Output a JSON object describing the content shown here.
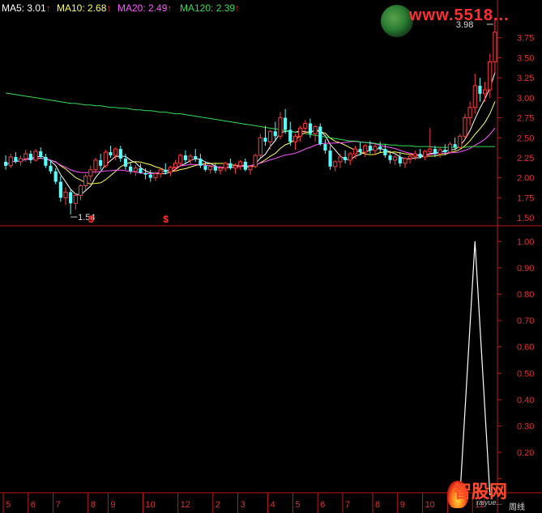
{
  "legend": [
    {
      "label": "MA5: 3.01",
      "color": "#ffffff"
    },
    {
      "label": "MA10: 2.68",
      "color": "#ffff55"
    },
    {
      "label": "MA20: 2.49",
      "color": "#ff55ff"
    },
    {
      "label": "MA120: 2.39",
      "color": "#33dd55"
    }
  ],
  "legend_arrow": "↑",
  "watermark_top": "www.5518...",
  "watermark_bottom": "智股网",
  "watermark_bottom_sub": "raiyue...",
  "period_label": "周线",
  "signal_marker": "$",
  "chart_data": [
    {
      "type": "candlestick",
      "panel": "price",
      "ylim": [
        1.42,
        4.0
      ],
      "yticks": [
        1.5,
        1.75,
        2.0,
        2.25,
        2.5,
        2.75,
        3.0,
        3.25,
        3.5,
        3.75
      ],
      "ytick_labels": [
        "1.50",
        "1.75",
        "2.00",
        "2.25",
        "2.50",
        "2.75",
        "3.00",
        "3.25",
        "3.50",
        "3.75"
      ],
      "annotations": [
        {
          "text": "1.54",
          "value": 1.54,
          "bar": 13
        },
        {
          "text": "3.98",
          "value": 3.98,
          "bar": 98
        }
      ],
      "signal_bars": [
        17,
        32
      ],
      "ohlc": [
        [
          2.2,
          2.28,
          2.1,
          2.15
        ],
        [
          2.15,
          2.3,
          2.12,
          2.26
        ],
        [
          2.26,
          2.32,
          2.18,
          2.2
        ],
        [
          2.2,
          2.28,
          2.15,
          2.24
        ],
        [
          2.24,
          2.35,
          2.2,
          2.3
        ],
        [
          2.3,
          2.34,
          2.18,
          2.22
        ],
        [
          2.22,
          2.36,
          2.2,
          2.33
        ],
        [
          2.33,
          2.38,
          2.24,
          2.26
        ],
        [
          2.26,
          2.3,
          2.12,
          2.15
        ],
        [
          2.15,
          2.22,
          2.05,
          2.08
        ],
        [
          2.08,
          2.12,
          1.92,
          1.95
        ],
        [
          1.95,
          2.02,
          1.7,
          1.75
        ],
        [
          1.75,
          1.88,
          1.66,
          1.82
        ],
        [
          1.82,
          1.86,
          1.54,
          1.68
        ],
        [
          1.68,
          1.8,
          1.6,
          1.78
        ],
        [
          1.78,
          1.92,
          1.72,
          1.9
        ],
        [
          1.9,
          2.05,
          1.85,
          2.02
        ],
        [
          2.02,
          2.15,
          1.95,
          2.1
        ],
        [
          2.1,
          2.25,
          2.05,
          2.22
        ],
        [
          2.22,
          2.3,
          2.1,
          2.15
        ],
        [
          2.15,
          2.35,
          2.12,
          2.32
        ],
        [
          2.32,
          2.4,
          2.25,
          2.28
        ],
        [
          2.28,
          2.38,
          2.22,
          2.36
        ],
        [
          2.36,
          2.4,
          2.2,
          2.24
        ],
        [
          2.24,
          2.3,
          2.1,
          2.14
        ],
        [
          2.14,
          2.2,
          2.05,
          2.08
        ],
        [
          2.08,
          2.16,
          2.02,
          2.12
        ],
        [
          2.12,
          2.18,
          2.05,
          2.06
        ],
        [
          2.06,
          2.12,
          1.98,
          2.04
        ],
        [
          2.04,
          2.1,
          1.95,
          2.0
        ],
        [
          2.0,
          2.08,
          1.96,
          2.05
        ],
        [
          2.05,
          2.12,
          2.0,
          2.1
        ],
        [
          2.1,
          2.18,
          2.04,
          2.07
        ],
        [
          2.07,
          2.15,
          2.02,
          2.13
        ],
        [
          2.13,
          2.22,
          2.08,
          2.18
        ],
        [
          2.18,
          2.3,
          2.14,
          2.28
        ],
        [
          2.28,
          2.34,
          2.18,
          2.22
        ],
        [
          2.22,
          2.3,
          2.16,
          2.27
        ],
        [
          2.27,
          2.36,
          2.2,
          2.24
        ],
        [
          2.24,
          2.3,
          2.12,
          2.15
        ],
        [
          2.15,
          2.2,
          2.08,
          2.1
        ],
        [
          2.1,
          2.16,
          2.05,
          2.14
        ],
        [
          2.14,
          2.18,
          2.06,
          2.09
        ],
        [
          2.09,
          2.15,
          2.04,
          2.12
        ],
        [
          2.12,
          2.2,
          2.08,
          2.18
        ],
        [
          2.18,
          2.24,
          2.1,
          2.12
        ],
        [
          2.12,
          2.18,
          2.05,
          2.15
        ],
        [
          2.15,
          2.22,
          2.1,
          2.2
        ],
        [
          2.2,
          2.24,
          2.08,
          2.1
        ],
        [
          2.1,
          2.16,
          2.04,
          2.14
        ],
        [
          2.14,
          2.3,
          2.12,
          2.28
        ],
        [
          2.28,
          2.55,
          2.25,
          2.5
        ],
        [
          2.5,
          2.65,
          2.4,
          2.45
        ],
        [
          2.45,
          2.6,
          2.35,
          2.58
        ],
        [
          2.58,
          2.7,
          2.45,
          2.52
        ],
        [
          2.52,
          2.82,
          2.48,
          2.75
        ],
        [
          2.75,
          2.86,
          2.55,
          2.6
        ],
        [
          2.6,
          2.7,
          2.4,
          2.45
        ],
        [
          2.45,
          2.55,
          2.35,
          2.52
        ],
        [
          2.52,
          2.65,
          2.45,
          2.62
        ],
        [
          2.62,
          2.72,
          2.55,
          2.68
        ],
        [
          2.68,
          2.74,
          2.5,
          2.55
        ],
        [
          2.55,
          2.66,
          2.45,
          2.64
        ],
        [
          2.64,
          2.68,
          2.4,
          2.42
        ],
        [
          2.42,
          2.48,
          2.3,
          2.34
        ],
        [
          2.34,
          2.4,
          2.1,
          2.14
        ],
        [
          2.14,
          2.22,
          2.08,
          2.2
        ],
        [
          2.2,
          2.3,
          2.12,
          2.26
        ],
        [
          2.26,
          2.34,
          2.18,
          2.22
        ],
        [
          2.22,
          2.32,
          2.16,
          2.3
        ],
        [
          2.3,
          2.4,
          2.24,
          2.36
        ],
        [
          2.36,
          2.44,
          2.28,
          2.32
        ],
        [
          2.32,
          2.42,
          2.26,
          2.4
        ],
        [
          2.4,
          2.46,
          2.3,
          2.34
        ],
        [
          2.34,
          2.42,
          2.28,
          2.39
        ],
        [
          2.39,
          2.45,
          2.32,
          2.36
        ],
        [
          2.36,
          2.42,
          2.25,
          2.28
        ],
        [
          2.28,
          2.34,
          2.18,
          2.22
        ],
        [
          2.22,
          2.3,
          2.16,
          2.26
        ],
        [
          2.26,
          2.32,
          2.14,
          2.18
        ],
        [
          2.18,
          2.26,
          2.12,
          2.24
        ],
        [
          2.24,
          2.3,
          2.18,
          2.27
        ],
        [
          2.27,
          2.34,
          2.22,
          2.3
        ],
        [
          2.3,
          2.36,
          2.24,
          2.26
        ],
        [
          2.26,
          2.35,
          2.22,
          2.33
        ],
        [
          2.33,
          2.62,
          2.28,
          2.36
        ],
        [
          2.36,
          2.4,
          2.26,
          2.3
        ],
        [
          2.3,
          2.38,
          2.25,
          2.35
        ],
        [
          2.35,
          2.42,
          2.28,
          2.32
        ],
        [
          2.32,
          2.45,
          2.3,
          2.42
        ],
        [
          2.42,
          2.5,
          2.34,
          2.38
        ],
        [
          2.38,
          2.55,
          2.35,
          2.52
        ],
        [
          2.52,
          2.8,
          2.48,
          2.75
        ],
        [
          2.75,
          2.95,
          2.65,
          2.88
        ],
        [
          2.88,
          3.3,
          2.8,
          3.15
        ],
        [
          3.15,
          3.25,
          2.95,
          3.05
        ],
        [
          3.05,
          3.2,
          2.95,
          3.1
        ],
        [
          3.1,
          3.55,
          3.0,
          3.45
        ],
        [
          3.45,
          3.98,
          3.3,
          3.82
        ]
      ],
      "series": [
        {
          "name": "MA5",
          "color": "#ffffff",
          "period": 5
        },
        {
          "name": "MA10",
          "color": "#ffff55",
          "period": 10
        },
        {
          "name": "MA20",
          "color": "#ff55ff",
          "period": 20
        },
        {
          "name": "MA120",
          "color": "#33dd55",
          "values": [
            3.06,
            3.05,
            3.04,
            3.03,
            3.02,
            3.01,
            3.0,
            2.99,
            2.98,
            2.97,
            2.96,
            2.95,
            2.94,
            2.93,
            2.93,
            2.92,
            2.91,
            2.91,
            2.9,
            2.9,
            2.89,
            2.88,
            2.88,
            2.87,
            2.87,
            2.86,
            2.85,
            2.85,
            2.84,
            2.84,
            2.83,
            2.82,
            2.82,
            2.81,
            2.8,
            2.8,
            2.79,
            2.78,
            2.77,
            2.76,
            2.75,
            2.74,
            2.73,
            2.72,
            2.71,
            2.7,
            2.69,
            2.68,
            2.67,
            2.66,
            2.65,
            2.64,
            2.63,
            2.62,
            2.61,
            2.6,
            2.59,
            2.58,
            2.57,
            2.56,
            2.55,
            2.54,
            2.53,
            2.52,
            2.51,
            2.5,
            2.49,
            2.48,
            2.47,
            2.46,
            2.46,
            2.45,
            2.44,
            2.44,
            2.43,
            2.42,
            2.42,
            2.41,
            2.41,
            2.4,
            2.4,
            2.4,
            2.39,
            2.39,
            2.39,
            2.39,
            2.38,
            2.38,
            2.38,
            2.38,
            2.38,
            2.38,
            2.38,
            2.39,
            2.39,
            2.39,
            2.39,
            2.39,
            2.39
          ]
        }
      ]
    },
    {
      "type": "line",
      "panel": "indicator",
      "ylim": [
        0.05,
        1.05
      ],
      "yticks": [
        0.1,
        0.2,
        0.3,
        0.4,
        0.5,
        0.6,
        0.7,
        0.8,
        0.9,
        1.0
      ],
      "ytick_labels": [
        "",
        "0.20",
        "0.30",
        "0.40",
        "0.50",
        "0.60",
        "0.70",
        "0.80",
        "0.90",
        "1.00"
      ],
      "spike": {
        "start_bar": 91,
        "peak_bar": 94,
        "end_bar": 97,
        "base": 0.0,
        "peak": 1.0
      }
    }
  ],
  "x_axis": {
    "tick_labels": [
      "5",
      "6",
      "7",
      "8",
      "9",
      "10",
      "12",
      "2",
      "3",
      "4",
      "5",
      "6",
      "7",
      "8",
      "9",
      "10",
      "11",
      "12"
    ],
    "tick_bars": [
      0,
      5,
      10,
      17,
      21,
      28,
      35,
      42,
      47,
      53,
      58,
      63,
      68,
      74,
      79,
      84,
      89,
      94
    ]
  }
}
